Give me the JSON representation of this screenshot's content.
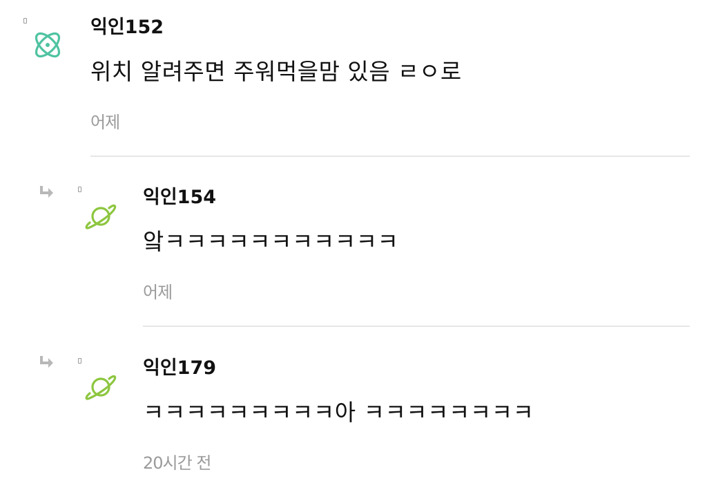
{
  "comments": [
    {
      "author": "익인152",
      "text": "위치 알려주면 주워먹을맘 있음 ㄹㅇ로",
      "time": "어제",
      "avatar_icon": "atom-icon",
      "avatar_color": "#4fc3a1",
      "is_reply": false
    },
    {
      "author": "익인154",
      "text": "앜ㅋㅋㅋㅋㅋㅋㅋㅋㅋㅋㅋ",
      "time": "어제",
      "avatar_icon": "planet-icon",
      "avatar_color": "#8dc63f",
      "is_reply": true
    },
    {
      "author": "익인179",
      "text": "ㅋㅋㅋㅋㅋㅋㅋㅋㅋ아 ㅋㅋㅋㅋㅋㅋㅋㅋ",
      "time": "20시간 전",
      "avatar_icon": "planet-icon",
      "avatar_color": "#8dc63f",
      "is_reply": true
    }
  ]
}
